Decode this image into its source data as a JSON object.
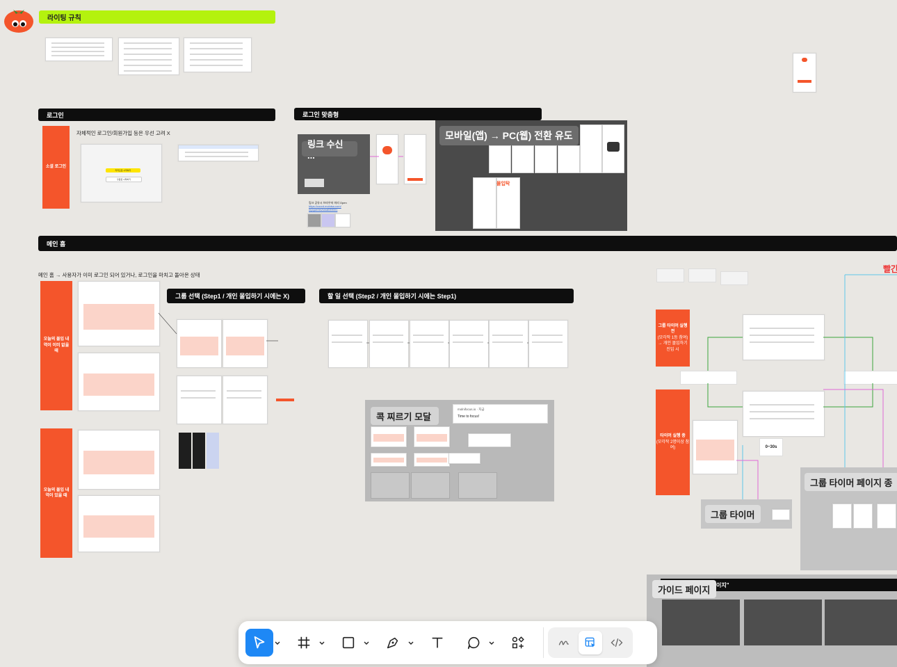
{
  "canvas": {
    "title_banner": "라이팅 규칙",
    "sections": {
      "login": "로그인",
      "login_custom": "로그인 맞춤형",
      "main_home": "메인 홈"
    },
    "notes": {
      "login_note": "자체적인 로그인/회원가입 등은 우선 고려 X",
      "main_home_note": "메인 홈 → 사용자가 이미 로그인 되어 있거나, 로그인을 마치고 돌아온 상태",
      "group_select": "그룹 선택 (Step1 / 개인 몰입하기 시에는 X)",
      "todo_select": "할 일  선택 (Step2 / 개인 몰입하기 시에는 Step1)",
      "red_partial": "빨간"
    },
    "orange_labels": {
      "social_login": "소셜 로그인",
      "no_history": "오늘의 몰입 내역이 이미 없을 때",
      "has_history": "오늘의 몰입 내역이 있을 때",
      "group_timer_before": "그룹 타이머 실행 전",
      "group_timer_before_sub": "(모각작 1등 참여)",
      "group_timer_before_sub2": "→ 개인 몰입하기 진입 시",
      "timer_running": "타이머 실행 중",
      "timer_running_sub": "(모각작 2명이상 참여)"
    },
    "panel_titles": {
      "link_receive": "링크 수신 ...",
      "mobile_to_pc": "모바일(앱) → PC(웹) 전환 유도",
      "poke_modal": "콕 찌르기 모달",
      "group_timer": "그룹 타이머",
      "group_timer_page": "그룹 타이머 페이지 종",
      "guide_page": "가이드 페이지",
      "guide_page_tag": "이지\""
    },
    "login_frame": {
      "kakao_btn": "카카오로 시작하기",
      "google_btn": "구글로 시작하기"
    },
    "link_notes": {
      "bullet1": "링크 공유시 브라우저 미리 Open",
      "bullet2": "https://coord.molnisa.com/",
      "bullet3": "mpqueries/small/89001"
    },
    "brand": "몰입탁",
    "notification": {
      "site": "molnifocus.io",
      "time": "지금",
      "message": "Time to focus!"
    },
    "side_mini_labels": [
      "0~30s"
    ],
    "colors": {
      "accent_orange": "#f4552b",
      "banner_green": "#b4f20e",
      "toolbar_active": "#1e88f5"
    }
  },
  "toolbar": {
    "tools": [
      {
        "name": "move",
        "icon": "cursor-arrow-icon",
        "active": true,
        "has_caret": true
      },
      {
        "name": "frame",
        "icon": "hash-frame-icon",
        "active": false,
        "has_caret": true
      },
      {
        "name": "shape",
        "icon": "rectangle-icon",
        "active": false,
        "has_caret": true
      },
      {
        "name": "pen",
        "icon": "pen-nib-icon",
        "active": false,
        "has_caret": true
      },
      {
        "name": "text",
        "icon": "text-t-icon",
        "active": false,
        "has_caret": false
      },
      {
        "name": "comment",
        "icon": "speech-bubble-icon",
        "active": false,
        "has_caret": true
      },
      {
        "name": "actions",
        "icon": "shapes-plus-icon",
        "active": false,
        "has_caret": false
      }
    ],
    "modes": [
      {
        "name": "draw",
        "icon": "squiggle-draw-icon",
        "active": false
      },
      {
        "name": "design",
        "icon": "design-mode-icon",
        "active": true
      },
      {
        "name": "dev",
        "icon": "code-brackets-icon",
        "active": false
      }
    ]
  }
}
